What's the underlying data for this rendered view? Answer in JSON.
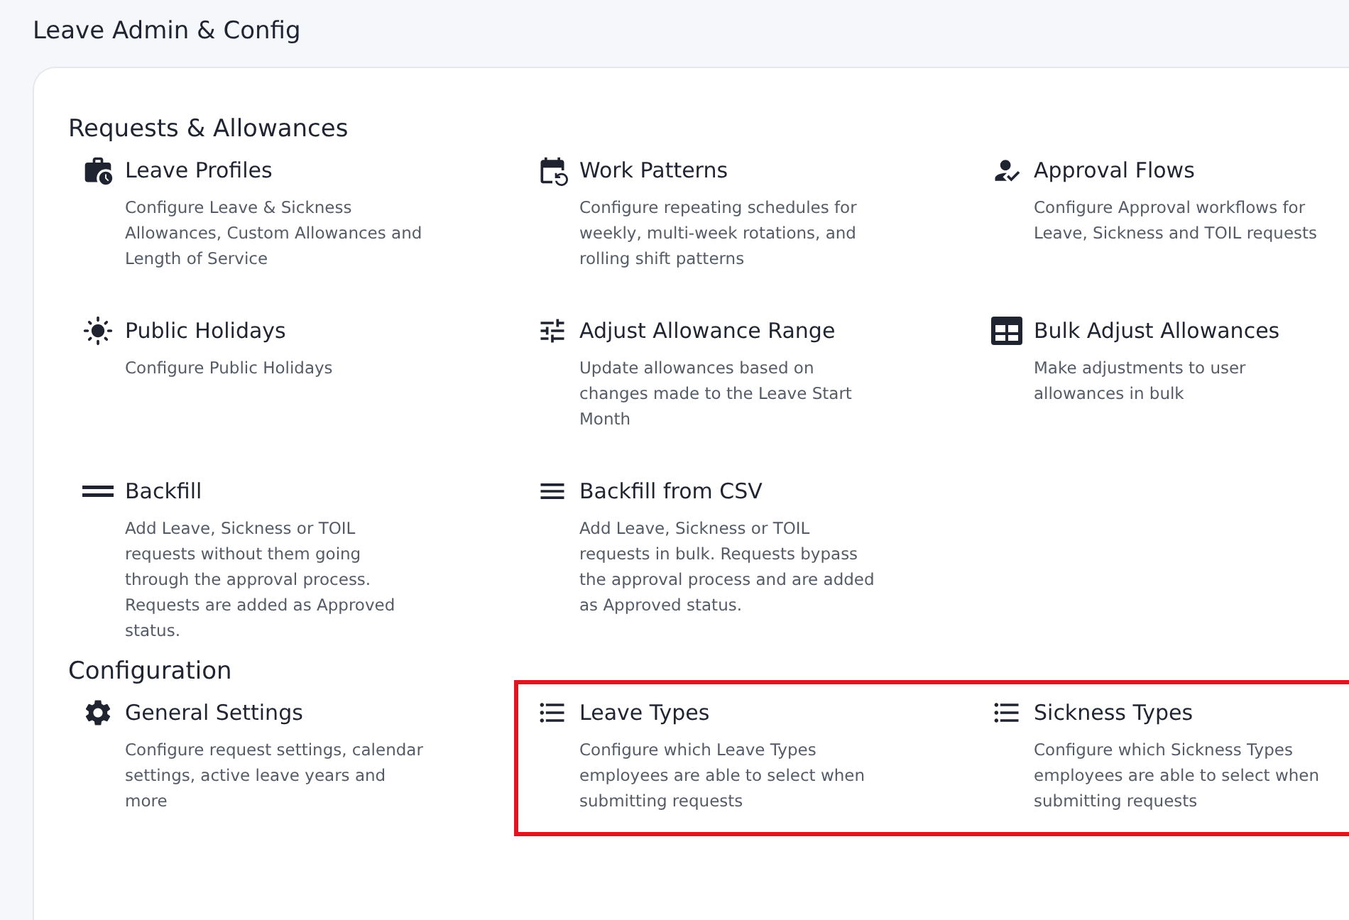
{
  "page_title": "Leave Admin & Config",
  "sections": [
    {
      "heading": "Requests & Allowances",
      "items": [
        {
          "kind": "briefcase",
          "title": "Leave Profiles",
          "description": "Configure Leave & Sickness Allowances, Custom Allowances and Length of Service",
          "highlighted": false
        },
        {
          "kind": "calendar",
          "title": "Work Patterns",
          "description": "Configure repeating schedules for weekly, multi-week rotations, and rolling shift patterns",
          "highlighted": false
        },
        {
          "kind": "approval",
          "title": "Approval Flows",
          "description": "Configure Approval workflows for Leave, Sickness and TOIL requests",
          "highlighted": false
        },
        {
          "kind": "sun",
          "title": "Public Holidays",
          "description": "Configure Public Holidays",
          "highlighted": false
        },
        {
          "kind": "sliders",
          "title": "Adjust Allowance Range",
          "description": "Update allowances based on changes made to the Leave Start Month",
          "highlighted": false
        },
        {
          "kind": "table",
          "title": "Bulk Adjust Allowances",
          "description": "Make adjustments to user allowances in bulk",
          "highlighted": false
        },
        {
          "kind": "two-lines",
          "title": "Backfill",
          "description": "Add Leave, Sickness or TOIL requests without them going through the approval process. Requests are added as Approved status.",
          "highlighted": false
        },
        {
          "kind": "three-lines",
          "title": "Backfill from CSV",
          "description": "Add Leave, Sickness or TOIL requests in bulk. Requests bypass the approval process and are added as Approved status.",
          "highlighted": false
        }
      ]
    },
    {
      "heading": "Configuration",
      "items": [
        {
          "kind": "gear",
          "title": "General Settings",
          "description": "Configure request settings, calendar settings, active leave years and more",
          "highlighted": false
        },
        {
          "kind": "list",
          "title": "Leave Types",
          "description": "Configure which Leave Types employees are able to select when submitting requests",
          "highlighted": true
        },
        {
          "kind": "list",
          "title": "Sickness Types",
          "description": "Configure which Sickness Types employees are able to select when submitting requests",
          "highlighted": true
        }
      ]
    }
  ]
}
